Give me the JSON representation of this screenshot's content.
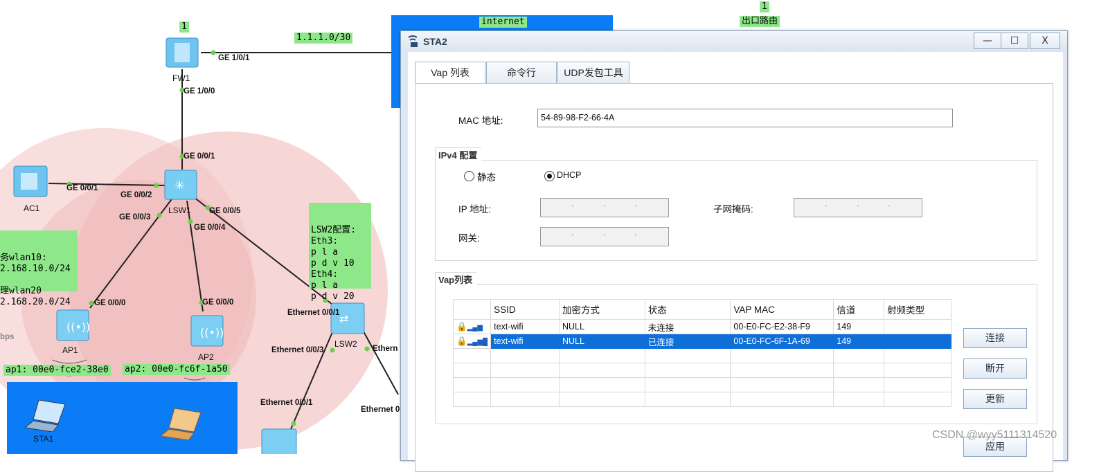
{
  "topology": {
    "top_labels": {
      "internet": "internet",
      "exit_router": "出口路由",
      "count_badge": "1",
      "count_badge_fw": "1"
    },
    "subnet_label": "1.1.1.0/30",
    "devices": {
      "fw1": "FW1",
      "lsw1": "LSW1",
      "lsw2": "LSW2",
      "ac1": "AC1",
      "ap1": "AP1",
      "ap2": "AP2",
      "sta1": "STA1",
      "sta2": "STA2"
    },
    "ports": {
      "fw_ge101": "GE 1/0/1",
      "fw_ge100": "GE 1/0/0",
      "lsw1_ge001": "GE 0/0/1",
      "ac_ge001": "GE 0/0/1",
      "lsw1_ge002": "GE 0/0/2",
      "lsw1_ge003": "GE 0/0/3",
      "lsw1_ge005": "GE 0/0/5",
      "lsw1_ge004": "GE 0/0/4",
      "ap1_ge000": "GE 0/0/0",
      "ap2_ge000": "GE 0/0/0",
      "lsw2_eth001": "Ethernet 0/0/1",
      "lsw2_eth003": "Ethernet 0/0/3",
      "lsw2_eth_right": "Ethern",
      "sw_eth001": "Ethernet 0/0/1",
      "eth_bottom": "Ethernet 0"
    },
    "wlan_note": [
      "务wlan10:",
      "2.168.10.0/24",
      "",
      "理wlan20",
      "2.168.20.0/24"
    ],
    "lsw2_note": [
      "LSW2配置:",
      "Eth3:",
      "p l a",
      "p d v 10",
      "Eth4:",
      "p l a",
      "p d v 20"
    ],
    "bps_label": "bps",
    "ap1_mac": "ap1: 00e0-fce2-38e0",
    "ap2_mac": "ap2: 00e0-fc6f-1a50"
  },
  "window": {
    "title": "STA2",
    "controls": {
      "minimize": "—",
      "maximize": "☐",
      "close": "X"
    },
    "tabs": [
      "Vap 列表",
      "命令行",
      "UDP发包工具"
    ],
    "mac_label": "MAC 地址:",
    "mac_value": "54-89-98-F2-66-4A",
    "ipv4_group": "IPv4 配置",
    "static_label": "静态",
    "dhcp_label": "DHCP",
    "ip_label": "IP 地址:",
    "mask_label": "子网掩码:",
    "gateway_label": "网关:",
    "ip_dots": ". . .",
    "vap_group": "Vap列表",
    "table": {
      "headers": [
        "",
        "SSID",
        "加密方式",
        "状态",
        "VAP MAC",
        "信道",
        "射频类型"
      ],
      "rows": [
        {
          "ssid": "text-wifi",
          "enc": "NULL",
          "status": "未连接",
          "mac": "00-E0-FC-E2-38-F9",
          "channel": "149",
          "radio": "",
          "selected": false
        },
        {
          "ssid": "text-wifi",
          "enc": "NULL",
          "status": "已连接",
          "mac": "00-E0-FC-6F-1A-69",
          "channel": "149",
          "radio": "",
          "selected": true
        }
      ]
    },
    "buttons": {
      "connect": "连接",
      "disconnect": "断开",
      "refresh": "更新",
      "apply": "应用"
    }
  },
  "watermark": "CSDN @wyy5111314520",
  "colors": {
    "accent_blue": "#0a7cf5",
    "label_green": "#8ee88a",
    "selection_blue": "#0f6fd8",
    "coverage_pink": "#f4c6c6"
  }
}
